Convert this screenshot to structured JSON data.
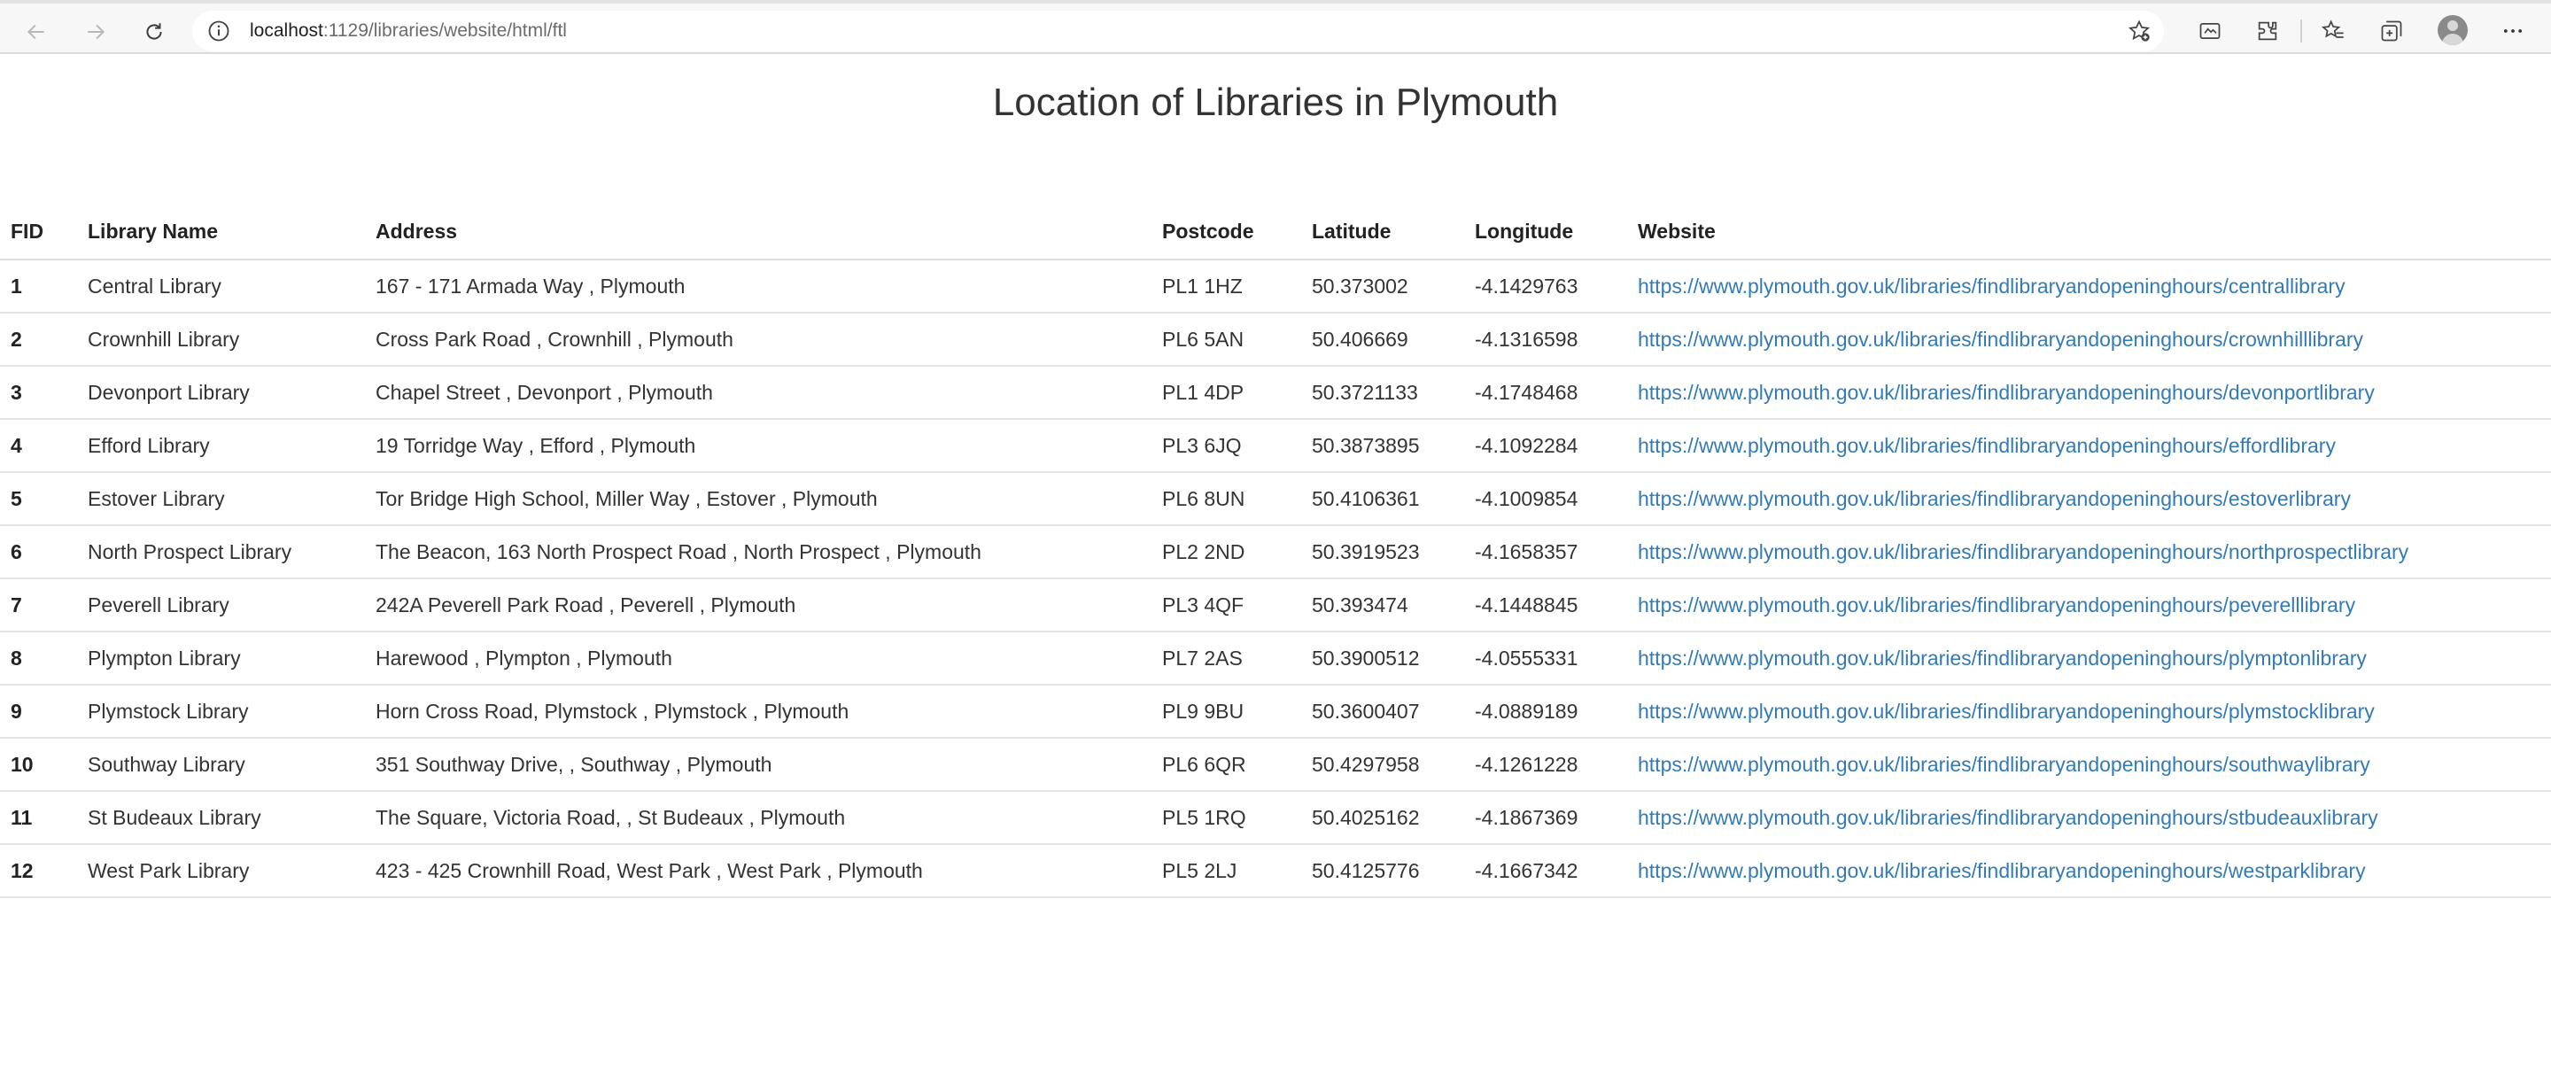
{
  "browser": {
    "url_host": "localhost",
    "url_path": ":1129/libraries/website/html/ftl"
  },
  "page": {
    "title": "Location of Libraries in Plymouth"
  },
  "table": {
    "headers": [
      "FID",
      "Library Name",
      "Address",
      "Postcode",
      "Latitude",
      "Longitude",
      "Website"
    ],
    "rows": [
      {
        "fid": "1",
        "name": "Central Library",
        "address": "167 - 171 Armada Way , Plymouth",
        "postcode": "PL1 1HZ",
        "lat": "50.373002",
        "lon": "-4.1429763",
        "website": "https://www.plymouth.gov.uk/libraries/findlibraryandopeninghours/centrallibrary"
      },
      {
        "fid": "2",
        "name": "Crownhill Library",
        "address": "Cross Park Road , Crownhill , Plymouth",
        "postcode": "PL6 5AN",
        "lat": "50.406669",
        "lon": "-4.1316598",
        "website": "https://www.plymouth.gov.uk/libraries/findlibraryandopeninghours/crownhilllibrary"
      },
      {
        "fid": "3",
        "name": "Devonport Library",
        "address": "Chapel Street , Devonport , Plymouth",
        "postcode": "PL1 4DP",
        "lat": "50.3721133",
        "lon": "-4.1748468",
        "website": "https://www.plymouth.gov.uk/libraries/findlibraryandopeninghours/devonportlibrary"
      },
      {
        "fid": "4",
        "name": "Efford Library",
        "address": "19 Torridge Way , Efford , Plymouth",
        "postcode": "PL3 6JQ",
        "lat": "50.3873895",
        "lon": "-4.1092284",
        "website": "https://www.plymouth.gov.uk/libraries/findlibraryandopeninghours/effordlibrary"
      },
      {
        "fid": "5",
        "name": "Estover Library",
        "address": "Tor Bridge High School, Miller Way , Estover , Plymouth",
        "postcode": "PL6 8UN",
        "lat": "50.4106361",
        "lon": "-4.1009854",
        "website": "https://www.plymouth.gov.uk/libraries/findlibraryandopeninghours/estoverlibrary"
      },
      {
        "fid": "6",
        "name": "North Prospect Library",
        "address": "The Beacon, 163 North Prospect Road , North Prospect , Plymouth",
        "postcode": "PL2 2ND",
        "lat": "50.3919523",
        "lon": "-4.1658357",
        "website": "https://www.plymouth.gov.uk/libraries/findlibraryandopeninghours/northprospectlibrary"
      },
      {
        "fid": "7",
        "name": "Peverell Library",
        "address": "242A Peverell Park Road , Peverell , Plymouth",
        "postcode": "PL3 4QF",
        "lat": "50.393474",
        "lon": "-4.1448845",
        "website": "https://www.plymouth.gov.uk/libraries/findlibraryandopeninghours/peverelllibrary"
      },
      {
        "fid": "8",
        "name": "Plympton Library",
        "address": "Harewood , Plympton , Plymouth",
        "postcode": "PL7 2AS",
        "lat": "50.3900512",
        "lon": "-4.0555331",
        "website": "https://www.plymouth.gov.uk/libraries/findlibraryandopeninghours/plymptonlibrary"
      },
      {
        "fid": "9",
        "name": "Plymstock Library",
        "address": "Horn Cross Road, Plymstock , Plymstock , Plymouth",
        "postcode": "PL9 9BU",
        "lat": "50.3600407",
        "lon": "-4.0889189",
        "website": "https://www.plymouth.gov.uk/libraries/findlibraryandopeninghours/plymstocklibrary"
      },
      {
        "fid": "10",
        "name": "Southway Library",
        "address": "351 Southway Drive, , Southway , Plymouth",
        "postcode": "PL6 6QR",
        "lat": "50.4297958",
        "lon": "-4.1261228",
        "website": "https://www.plymouth.gov.uk/libraries/findlibraryandopeninghours/southwaylibrary"
      },
      {
        "fid": "11",
        "name": "St Budeaux Library",
        "address": "The Square, Victoria Road, , St Budeaux , Plymouth",
        "postcode": "PL5 1RQ",
        "lat": "50.4025162",
        "lon": "-4.1867369",
        "website": "https://www.plymouth.gov.uk/libraries/findlibraryandopeninghours/stbudeauxlibrary"
      },
      {
        "fid": "12",
        "name": "West Park Library",
        "address": "423 - 425 Crownhill Road, West Park , West Park , Plymouth",
        "postcode": "PL5 2LJ",
        "lat": "50.4125776",
        "lon": "-4.1667342",
        "website": "https://www.plymouth.gov.uk/libraries/findlibraryandopeninghours/westparklibrary"
      }
    ]
  },
  "colors": {
    "link": "#337ab7",
    "toolbar_bg": "#f7f7f7"
  },
  "icons": [
    "back-arrow-icon",
    "forward-arrow-icon",
    "reload-icon",
    "info-icon",
    "favorite-add-icon",
    "immersive-reader-icon",
    "extensions-icon",
    "favorites-icon",
    "collections-icon",
    "profile-avatar",
    "more-menu-icon"
  ]
}
